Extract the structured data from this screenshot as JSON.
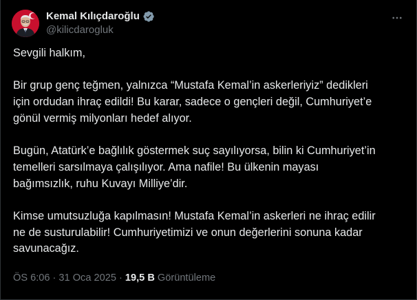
{
  "author": {
    "display_name": "Kemal Kılıçdaroğlu",
    "handle": "@kilicdarogluk",
    "verified": true,
    "avatar_icon": "profile-photo"
  },
  "menu": {
    "icon": "more-horizontal-icon"
  },
  "tweet": {
    "text": "Sevgili halkım,\n\nBir grup genç teğmen, yalnızca “Mustafa Kemal’in askerleriyiz” dedikleri\niçin ordudan ihraç edildi! Bu karar, sadece o gençleri değil, Cumhuriyet’e\ngönül vermiş milyonları hedef alıyor.\n\nBugün, Atatürk’e bağlılık göstermek suç sayılıyorsa, bilin ki Cumhuriyet’in\ntemelleri sarsılmaya çalışılıyor. Ama nafile! Bu ülkenin mayası\nbağımsızlık, ruhu Kuvayı Milliye’dir.\n\nKimse umutsuzluğa kapılmasın! Mustafa Kemal’in askerleri ne ihraç edilir\nne de susturulabilir! Cumhuriyetimizi ve onun değerlerini sonuna kadar\nsavunacağız."
  },
  "meta": {
    "time": "ÖS 6:06",
    "separator": "·",
    "date": "31 Oca 2025",
    "views_count": "19,5 B",
    "views_label": "Görüntüleme"
  },
  "colors": {
    "background": "#000000",
    "text": "#e7e9ea",
    "muted": "#71767b",
    "verified_badge": "#829aab"
  }
}
